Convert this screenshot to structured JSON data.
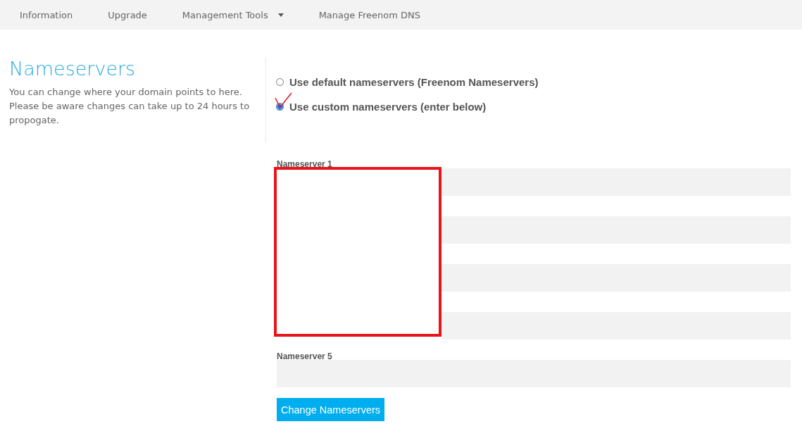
{
  "nav": [
    {
      "label": "Information",
      "dropdown": false
    },
    {
      "label": "Upgrade",
      "dropdown": false
    },
    {
      "label": "Management Tools",
      "dropdown": true
    },
    {
      "label": "Manage Freenom DNS",
      "dropdown": false
    }
  ],
  "intro": {
    "title": "Nameservers",
    "text": "You can change where your domain points to here. Please be aware changes can take up to 24 hours to propogate."
  },
  "options": [
    {
      "label": "Use default nameservers (Freenom Nameservers)",
      "selected": false
    },
    {
      "label": "Use custom nameservers (enter below)",
      "selected": true
    }
  ],
  "fields": [
    {
      "label": "Nameserver 1",
      "redacted": true
    },
    {
      "redacted": true
    },
    {
      "redacted": true
    },
    {
      "redacted": true
    },
    {
      "label": "Nameserver 5",
      "redacted": false
    }
  ],
  "button": "Change Nameservers"
}
